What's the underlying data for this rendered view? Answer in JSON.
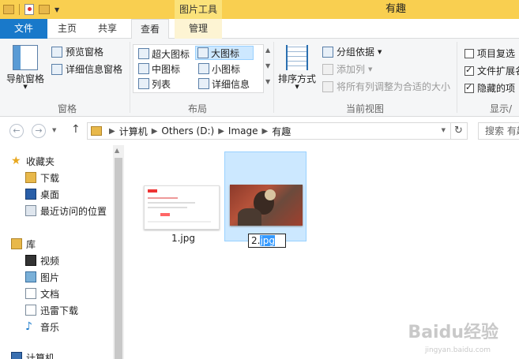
{
  "window": {
    "title": "有趣",
    "context_tab_title": "图片工具",
    "accent": "#1979ca",
    "titlebar_color": "#f9cf50"
  },
  "tabs": {
    "file": "文件",
    "items": [
      "主页",
      "共享",
      "查看",
      "管理"
    ],
    "active": "查看"
  },
  "ribbon": {
    "panes": {
      "label": "窗格",
      "nav_pane": "导航窗格",
      "preview_pane": "预览窗格",
      "details_pane": "详细信息窗格"
    },
    "layout": {
      "label": "布局",
      "items": [
        "超大图标",
        "大图标",
        "中图标",
        "小图标",
        "列表",
        "详细信息"
      ],
      "selected": "大图标"
    },
    "current_view": {
      "label": "当前视图",
      "sort_by": "排序方式",
      "group_by": "分组依据",
      "add_column": "添加列",
      "fit_columns": "将所有列调整为合适的大小"
    },
    "show_hide": {
      "label": "显示/",
      "item_checkboxes": "项目复选",
      "file_extensions": "文件扩展名",
      "hidden_items": "隐藏的项"
    }
  },
  "address": {
    "crumbs": [
      "计算机",
      "Others (D:)",
      "Image",
      "有趣"
    ],
    "search_placeholder": "搜索 有趣"
  },
  "navpane": {
    "favorites": "收藏夹",
    "favorites_items": [
      "下载",
      "桌面",
      "最近访问的位置"
    ],
    "library": "库",
    "library_items": [
      "视频",
      "图片",
      "文档",
      "迅雷下载",
      "音乐"
    ],
    "computer": "计算机"
  },
  "files": [
    {
      "name": "1.jpg"
    },
    {
      "name": "2.jpg",
      "rename_base": "2.",
      "rename_selected": "jpg"
    }
  ],
  "watermark": {
    "text": "Baidu经验",
    "sub": "jingyan.baidu.com"
  }
}
